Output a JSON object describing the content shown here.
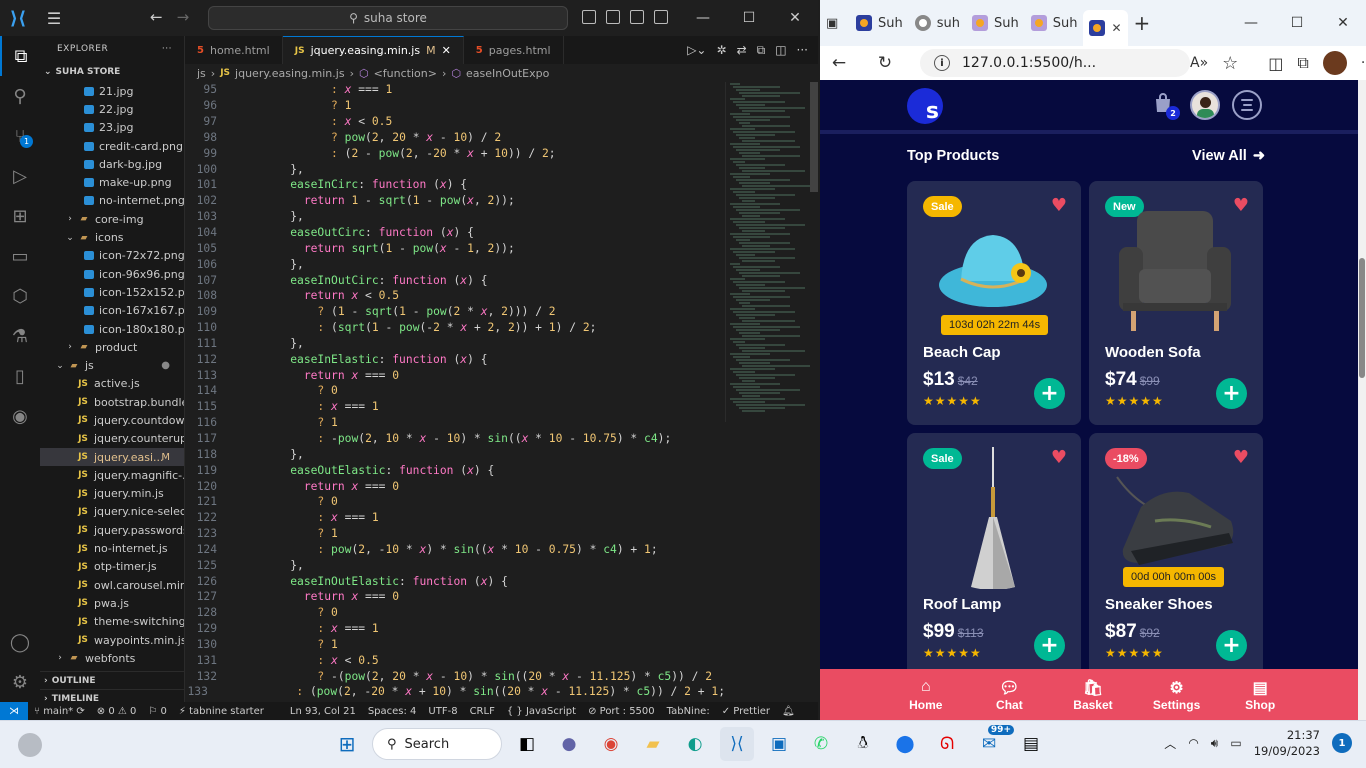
{
  "vscode": {
    "search_text": "suha store",
    "explorer_label": "EXPLORER",
    "root_label": "SUHA STORE",
    "scm_badge": "1",
    "tree": [
      {
        "label": "21.jpg",
        "type": "img",
        "indent": 2
      },
      {
        "label": "22.jpg",
        "type": "img",
        "indent": 2
      },
      {
        "label": "23.jpg",
        "type": "img",
        "indent": 2
      },
      {
        "label": "credit-card.png",
        "type": "img",
        "indent": 2
      },
      {
        "label": "dark-bg.jpg",
        "type": "img",
        "indent": 2
      },
      {
        "label": "make-up.png",
        "type": "img",
        "indent": 2
      },
      {
        "label": "no-internet.png",
        "type": "img",
        "indent": 2
      },
      {
        "label": "core-img",
        "type": "folder",
        "indent": 1
      },
      {
        "label": "icons",
        "type": "folder-open",
        "indent": 1
      },
      {
        "label": "icon-72x72.png",
        "type": "img",
        "indent": 2
      },
      {
        "label": "icon-96x96.png",
        "type": "img",
        "indent": 2
      },
      {
        "label": "icon-152x152.p...",
        "type": "img",
        "indent": 2
      },
      {
        "label": "icon-167x167.p...",
        "type": "img",
        "indent": 2
      },
      {
        "label": "icon-180x180.p...",
        "type": "img",
        "indent": 2
      },
      {
        "label": "product",
        "type": "folder",
        "indent": 1
      },
      {
        "label": "js",
        "type": "folder-open-root",
        "indent": 0,
        "dot": true
      },
      {
        "label": "active.js",
        "type": "js",
        "indent": 1
      },
      {
        "label": "bootstrap.bundle...",
        "type": "js",
        "indent": 1
      },
      {
        "label": "jquery.countdow...",
        "type": "js",
        "indent": 1
      },
      {
        "label": "jquery.counterup...",
        "type": "js",
        "indent": 1
      },
      {
        "label": "jquery.easi...",
        "type": "js",
        "indent": 1,
        "selected": true,
        "modified": "M"
      },
      {
        "label": "jquery.magnific-...",
        "type": "js",
        "indent": 1
      },
      {
        "label": "jquery.min.js",
        "type": "js",
        "indent": 1
      },
      {
        "label": "jquery.nice-selec...",
        "type": "js",
        "indent": 1
      },
      {
        "label": "jquery.passwords...",
        "type": "js",
        "indent": 1
      },
      {
        "label": "no-internet.js",
        "type": "js",
        "indent": 1
      },
      {
        "label": "otp-timer.js",
        "type": "js",
        "indent": 1
      },
      {
        "label": "owl.carousel.min.js",
        "type": "js",
        "indent": 1
      },
      {
        "label": "pwa.js",
        "type": "js",
        "indent": 1
      },
      {
        "label": "theme-switching.js",
        "type": "js",
        "indent": 1
      },
      {
        "label": "waypoints.min.js",
        "type": "js",
        "indent": 1
      },
      {
        "label": "webfonts",
        "type": "folder",
        "indent": 0
      }
    ],
    "outline_label": "OUTLINE",
    "timeline_label": "TIMELINE",
    "tabs": [
      {
        "label": "home.html",
        "kind": "html"
      },
      {
        "label": "jquery.easing.min.js",
        "kind": "js",
        "active": true,
        "modified": "M"
      },
      {
        "label": "pages.html",
        "kind": "html"
      }
    ],
    "breadcrumb": [
      "js",
      "jquery.easing.min.js",
      "<function>",
      "easeInOutExpo"
    ],
    "code_lines": [
      {
        "n": "95",
        "html": "          <span class='p'>:</span> <span class='v'>x</span> === <span class='n'>1</span>"
      },
      {
        "n": "96",
        "html": "          <span class='p'>?</span> <span class='n'>1</span>"
      },
      {
        "n": "97",
        "html": "          <span class='p'>:</span> <span class='v'>x</span> &lt; <span class='n'>0.5</span>"
      },
      {
        "n": "98",
        "html": "          <span class='p'>?</span> <span class='f'>pow</span>(<span class='n'>2</span>, <span class='n'>20</span> * <span class='v'>x</span> - <span class='n'>10</span>) / <span class='n'>2</span>"
      },
      {
        "n": "99",
        "html": "          <span class='p'>:</span> (<span class='n'>2</span> - <span class='f'>pow</span>(<span class='n'>2</span>, -<span class='n'>20</span> * <span class='v'>x</span> + <span class='n'>10</span>)) / <span class='n'>2</span>;"
      },
      {
        "n": "100",
        "html": "    },"
      },
      {
        "n": "101",
        "html": "    <span class='f'>easeInCirc</span>: <span class='k'>function</span> (<span class='v'>x</span>) {"
      },
      {
        "n": "102",
        "html": "      <span class='k'>return</span> <span class='n'>1</span> - <span class='f'>sqrt</span>(<span class='n'>1</span> - <span class='f'>pow</span>(<span class='v'>x</span>, <span class='n'>2</span>));"
      },
      {
        "n": "103",
        "html": "    },"
      },
      {
        "n": "104",
        "html": "    <span class='f'>easeOutCirc</span>: <span class='k'>function</span> (<span class='v'>x</span>) {"
      },
      {
        "n": "105",
        "html": "      <span class='k'>return</span> <span class='f'>sqrt</span>(<span class='n'>1</span> - <span class='f'>pow</span>(<span class='v'>x</span> - <span class='n'>1</span>, <span class='n'>2</span>));"
      },
      {
        "n": "106",
        "html": "    },"
      },
      {
        "n": "107",
        "html": "    <span class='f'>easeInOutCirc</span>: <span class='k'>function</span> (<span class='v'>x</span>) {"
      },
      {
        "n": "108",
        "html": "      <span class='k'>return</span> <span class='v'>x</span> &lt; <span class='n'>0.5</span>"
      },
      {
        "n": "109",
        "html": "        <span class='p'>?</span> (<span class='n'>1</span> - <span class='f'>sqrt</span>(<span class='n'>1</span> - <span class='f'>pow</span>(<span class='n'>2</span> * <span class='v'>x</span>, <span class='n'>2</span>))) / <span class='n'>2</span>"
      },
      {
        "n": "110",
        "html": "        <span class='p'>:</span> (<span class='f'>sqrt</span>(<span class='n'>1</span> - <span class='f'>pow</span>(-<span class='n'>2</span> * <span class='v'>x</span> + <span class='n'>2</span>, <span class='n'>2</span>)) + <span class='n'>1</span>) / <span class='n'>2</span>;"
      },
      {
        "n": "111",
        "html": "    },"
      },
      {
        "n": "112",
        "html": "    <span class='f'>easeInElastic</span>: <span class='k'>function</span> (<span class='v'>x</span>) {"
      },
      {
        "n": "113",
        "html": "      <span class='k'>return</span> <span class='v'>x</span> === <span class='n'>0</span>"
      },
      {
        "n": "114",
        "html": "        <span class='p'>?</span> <span class='n'>0</span>"
      },
      {
        "n": "115",
        "html": "        <span class='p'>:</span> <span class='v'>x</span> === <span class='n'>1</span>"
      },
      {
        "n": "116",
        "html": "        <span class='p'>?</span> <span class='n'>1</span>"
      },
      {
        "n": "117",
        "html": "        <span class='p'>:</span> -<span class='f'>pow</span>(<span class='n'>2</span>, <span class='n'>10</span> * <span class='v'>x</span> - <span class='n'>10</span>) * <span class='f'>sin</span>((<span class='v'>x</span> * <span class='n'>10</span> - <span class='n'>10.75</span>) * <span class='f'>c4</span>);"
      },
      {
        "n": "118",
        "html": "    },"
      },
      {
        "n": "119",
        "html": "    <span class='f'>easeOutElastic</span>: <span class='k'>function</span> (<span class='v'>x</span>) {"
      },
      {
        "n": "120",
        "html": "      <span class='k'>return</span> <span class='v'>x</span> === <span class='n'>0</span>"
      },
      {
        "n": "121",
        "html": "        <span class='p'>?</span> <span class='n'>0</span>"
      },
      {
        "n": "122",
        "html": "        <span class='p'>:</span> <span class='v'>x</span> === <span class='n'>1</span>"
      },
      {
        "n": "123",
        "html": "        <span class='p'>?</span> <span class='n'>1</span>"
      },
      {
        "n": "124",
        "html": "        <span class='p'>:</span> <span class='f'>pow</span>(<span class='n'>2</span>, -<span class='n'>10</span> * <span class='v'>x</span>) * <span class='f'>sin</span>((<span class='v'>x</span> * <span class='n'>10</span> - <span class='n'>0.75</span>) * <span class='f'>c4</span>) + <span class='n'>1</span>;"
      },
      {
        "n": "125",
        "html": "    },"
      },
      {
        "n": "126",
        "html": "    <span class='f'>easeInOutElastic</span>: <span class='k'>function</span> (<span class='v'>x</span>) {"
      },
      {
        "n": "127",
        "html": "      <span class='k'>return</span> <span class='v'>x</span> === <span class='n'>0</span>"
      },
      {
        "n": "128",
        "html": "        <span class='p'>?</span> <span class='n'>0</span>"
      },
      {
        "n": "129",
        "html": "        <span class='p'>:</span> <span class='v'>x</span> === <span class='n'>1</span>"
      },
      {
        "n": "130",
        "html": "        <span class='p'>?</span> <span class='n'>1</span>"
      },
      {
        "n": "131",
        "html": "        <span class='p'>:</span> <span class='v'>x</span> &lt; <span class='n'>0.5</span>"
      },
      {
        "n": "132",
        "html": "        <span class='p'>?</span> -(<span class='f'>pow</span>(<span class='n'>2</span>, <span class='n'>20</span> * <span class='v'>x</span> - <span class='n'>10</span>) * <span class='f'>sin</span>((<span class='n'>20</span> * <span class='v'>x</span> - <span class='n'>11.125</span>) * <span class='f'>c5</span>)) / <span class='n'>2</span>"
      },
      {
        "n": "133",
        "html": "        <span class='p'>:</span> (<span class='f'>pow</span>(<span class='n'>2</span>, -<span class='n'>20</span> * <span class='v'>x</span> + <span class='n'>10</span>) * <span class='f'>sin</span>((<span class='n'>20</span> * <span class='v'>x</span> - <span class='n'>11.125</span>) * <span class='f'>c5</span>)) / <span class='n'>2</span> + <span class='n'>1</span>;"
      }
    ],
    "status": {
      "branch": "main*",
      "errors": "0",
      "warnings": "0",
      "ports": "0",
      "tabnine": "tabnine starter",
      "position": "Ln 93, Col 21",
      "spaces": "Spaces: 4",
      "encoding": "UTF-8",
      "eol": "CRLF",
      "language": "JavaScript",
      "port": "Port : 5500",
      "tabnine_short": "TabNine:",
      "prettier": "Prettier"
    }
  },
  "browser": {
    "tabs": [
      {
        "label": "Suh"
      },
      {
        "label": "suh"
      },
      {
        "label": "Suh"
      },
      {
        "label": "Suh"
      },
      {
        "label": "",
        "active": true
      }
    ],
    "url": "127.0.0.1:5500/h...",
    "app": {
      "logo_letter": "s",
      "cart_count": "2",
      "section_title": "Top Products",
      "view_all": "View All",
      "products": [
        {
          "name": "Beach Cap",
          "price": "$13",
          "old_price": "$42",
          "badge": "Sale",
          "badge_color": "#f5b700",
          "timer": "103d 02h 22m 44s",
          "image": "hat"
        },
        {
          "name": "Wooden Sofa",
          "price": "$74",
          "old_price": "$99",
          "badge": "New",
          "badge_color": "#00b894",
          "timer": "",
          "image": "sofa"
        },
        {
          "name": "Roof Lamp",
          "price": "$99",
          "old_price": "$113",
          "badge": "Sale",
          "badge_color": "#00b894",
          "timer": "",
          "image": "lamp"
        },
        {
          "name": "Sneaker Shoes",
          "price": "$87",
          "old_price": "$92",
          "badge": "-18%",
          "badge_color": "#ea4c62",
          "timer": "00d 00h 00m 00s",
          "image": "shoe"
        }
      ],
      "rating_stars": "★★★★★",
      "nav": [
        {
          "label": "Home",
          "icon": "home-icon"
        },
        {
          "label": "Chat",
          "icon": "chat-icon"
        },
        {
          "label": "Basket",
          "icon": "basket-icon"
        },
        {
          "label": "Settings",
          "icon": "settings-icon"
        },
        {
          "label": "Shop",
          "icon": "shop-icon"
        }
      ]
    }
  },
  "taskbar": {
    "search_label": "Search",
    "time": "21:37",
    "date": "19/09/2023",
    "notif_count": "1",
    "mail_badge": "99+"
  }
}
